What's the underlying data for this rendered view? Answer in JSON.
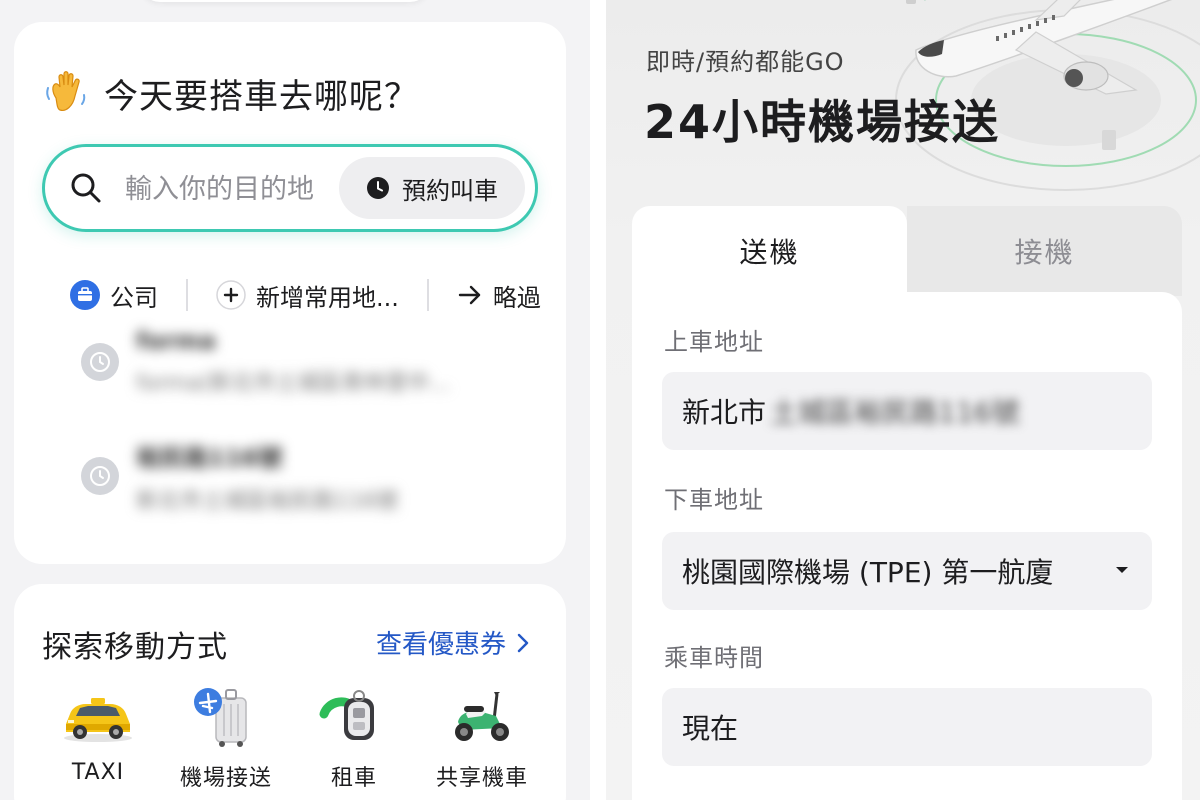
{
  "left": {
    "greeting": "今天要搭車去哪呢？",
    "search": {
      "placeholder": "輸入你的目的地",
      "reserve_label": "預約叫車"
    },
    "shortcuts": {
      "company": "公司",
      "add_place": "新增常用地...",
      "skip": "略過"
    },
    "recent": [
      {
        "title": "forma",
        "subtitle": "forma(新北市土城區青林里中..."
      },
      {
        "title": "裕民路116號",
        "subtitle": "新北市土城區裕民路116號"
      }
    ],
    "explore": {
      "title": "探索移動方式",
      "coupon_link": "查看優惠券",
      "modes": [
        {
          "label": "TAXI",
          "icon": "taxi-icon"
        },
        {
          "label": "機場接送",
          "icon": "airport-luggage-icon"
        },
        {
          "label": "租車",
          "icon": "car-key-icon"
        },
        {
          "label": "共享機車",
          "icon": "scooter-icon"
        }
      ]
    }
  },
  "right": {
    "hero_subtitle": "即時/預約都能GO",
    "hero_title": "24小時機場接送",
    "tabs": {
      "dropoff": "送機",
      "pickup": "接機"
    },
    "pickup_label": "上車地址",
    "pickup_prefix": "新北市",
    "pickup_blurred": "土城區裕民路116號",
    "dropoff_label": "下車地址",
    "dropoff_value": "桃園國際機場 (TPE) 第一航廈",
    "time_label": "乘車時間",
    "time_value": "現在"
  },
  "colors": {
    "search_border": "#3ec9b2",
    "link": "#2458c6",
    "company_badge": "#2f6fe4",
    "scooter_green": "#3cb371"
  }
}
